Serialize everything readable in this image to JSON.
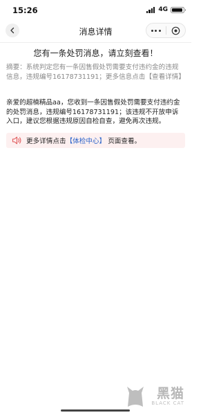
{
  "status_bar": {
    "time": "15:26",
    "network": "4G"
  },
  "nav": {
    "title": "消息详情",
    "back_icon": "chevron-left-icon",
    "more_icon": "more-dots-icon",
    "close_icon": "target-circle-icon"
  },
  "message": {
    "headline": "您有一条处罚消息，请立刻查看！",
    "summary": "摘要：系统判定您有一条因售假处罚需要支付违约金的违规信息，违规编号16178731191；更多信息点击【查看详情】",
    "body": "亲爱的超楠精品aa，您收到一条因售假处罚需要支付违约金的处罚消息，违规编号16178731191；该违规不开放申诉入口，建议您根据违规原因自检自查，避免再次违规。"
  },
  "notice": {
    "icon": "speaker-icon",
    "prefix": "更多详情点击",
    "link": "【体检中心】",
    "suffix": "页面查看。",
    "bg_color": "#fdf0f0",
    "link_color": "#2a62c9"
  },
  "watermark": {
    "text_cn": "黑猫",
    "text_en": "BLACK CAT"
  }
}
